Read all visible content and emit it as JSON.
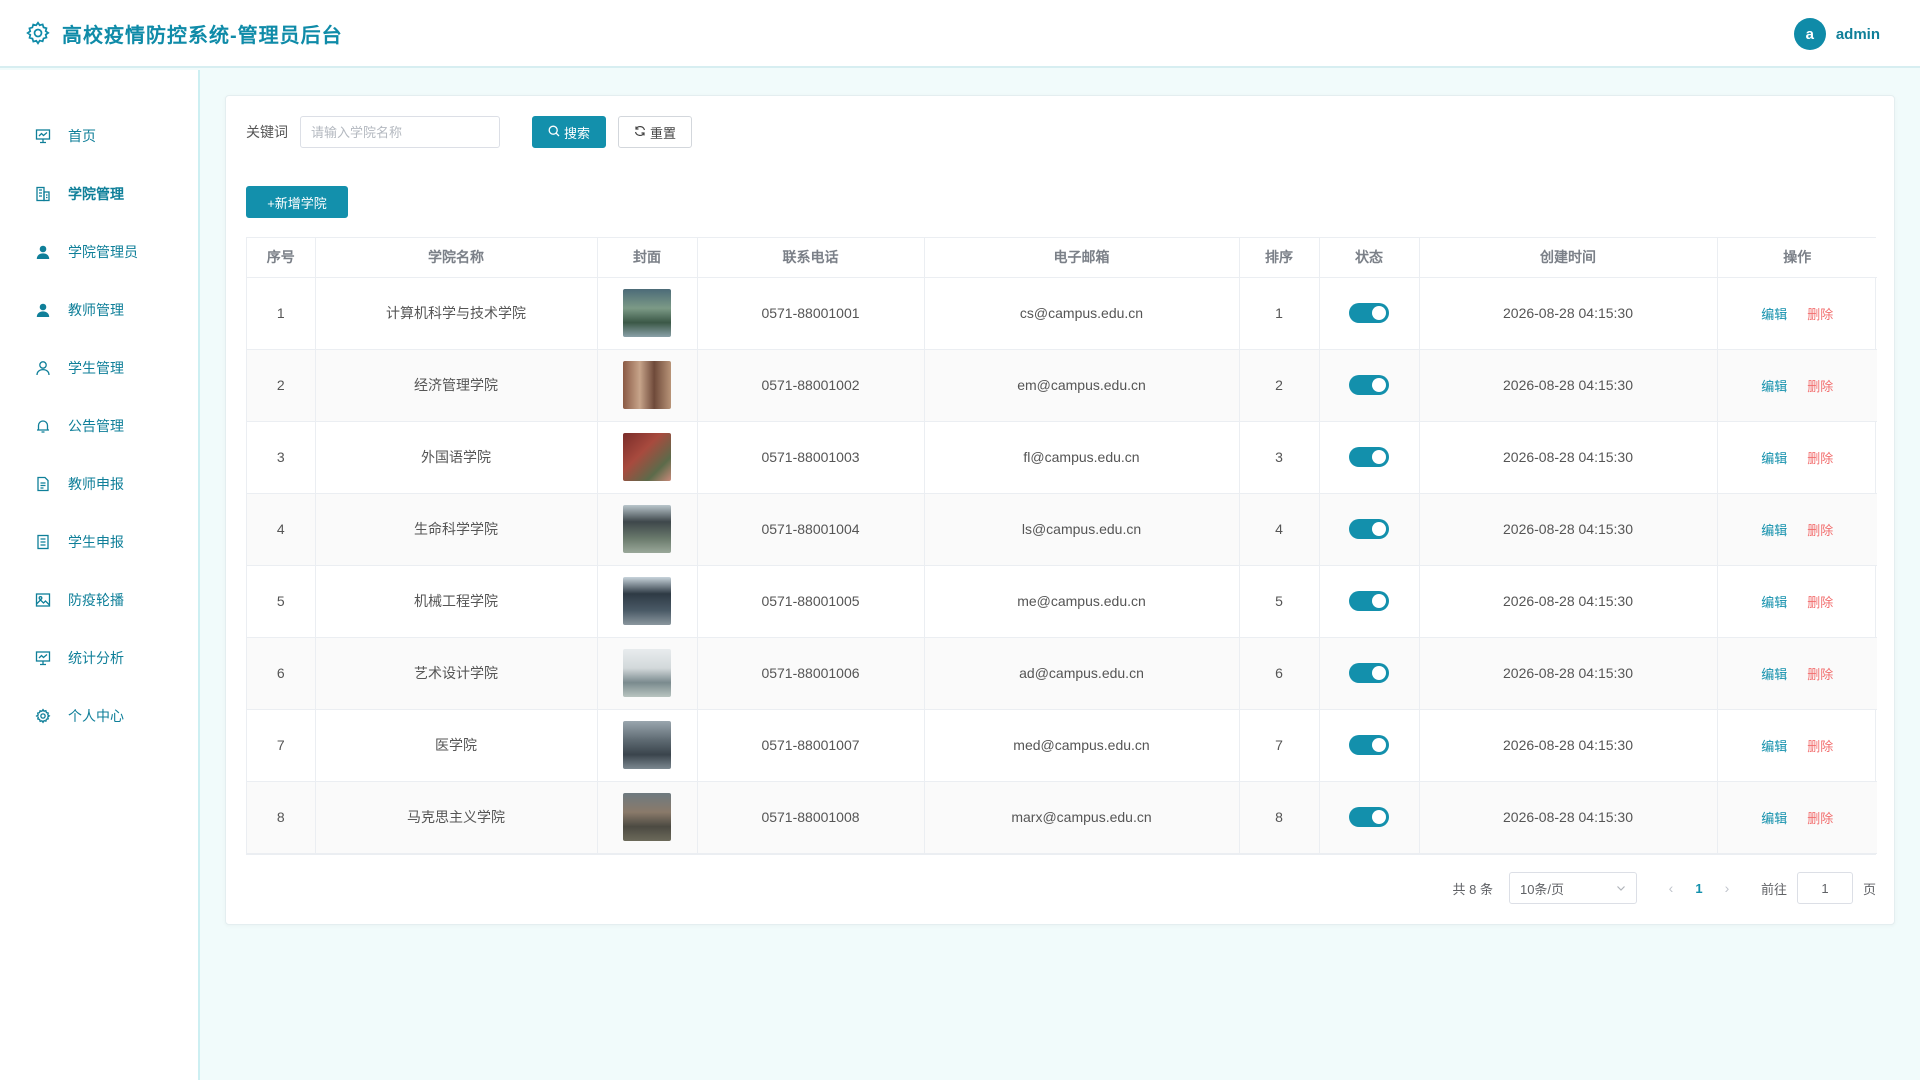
{
  "header": {
    "title": "高校疫情防控系统-管理员后台",
    "logo_icon": "gear-icon",
    "user": {
      "avatar_letter": "a",
      "name": "admin"
    }
  },
  "sidebar": {
    "items": [
      {
        "label": "首页",
        "icon": "presentation-icon"
      },
      {
        "label": "学院管理",
        "icon": "building-icon",
        "active": true
      },
      {
        "label": "学院管理员",
        "icon": "user-filled-icon"
      },
      {
        "label": "教师管理",
        "icon": "user-filled-icon"
      },
      {
        "label": "学生管理",
        "icon": "user-outline-icon"
      },
      {
        "label": "公告管理",
        "icon": "bell-icon"
      },
      {
        "label": "教师申报",
        "icon": "document-icon"
      },
      {
        "label": "学生申报",
        "icon": "tickets-icon"
      },
      {
        "label": "防疫轮播",
        "icon": "picture-icon"
      },
      {
        "label": "统计分析",
        "icon": "presentation-icon"
      },
      {
        "label": "个人中心",
        "icon": "gear-icon"
      }
    ]
  },
  "search": {
    "keyword_label": "关键词",
    "keyword_placeholder": "请输入学院名称",
    "keyword_value": "",
    "search_label": "搜索",
    "reset_label": "重置"
  },
  "toolbar": {
    "add_label": "+新增学院"
  },
  "table": {
    "columns": [
      "序号",
      "学院名称",
      "封面",
      "联系电话",
      "电子邮箱",
      "排序",
      "状态",
      "创建时间",
      "操作"
    ],
    "edit_label": "编辑",
    "delete_label": "删除",
    "rows": [
      {
        "index": "1",
        "name": "计算机科学与技术学院",
        "phone": "0571-88001001",
        "email": "cs@campus.edu.cn",
        "sort": "1",
        "status": true,
        "created": "2026-08-28 04:15:30"
      },
      {
        "index": "2",
        "name": "经济管理学院",
        "phone": "0571-88001002",
        "email": "em@campus.edu.cn",
        "sort": "2",
        "status": true,
        "created": "2026-08-28 04:15:30"
      },
      {
        "index": "3",
        "name": "外国语学院",
        "phone": "0571-88001003",
        "email": "fl@campus.edu.cn",
        "sort": "3",
        "status": true,
        "created": "2026-08-28 04:15:30"
      },
      {
        "index": "4",
        "name": "生命科学学院",
        "phone": "0571-88001004",
        "email": "ls@campus.edu.cn",
        "sort": "4",
        "status": true,
        "created": "2026-08-28 04:15:30"
      },
      {
        "index": "5",
        "name": "机械工程学院",
        "phone": "0571-88001005",
        "email": "me@campus.edu.cn",
        "sort": "5",
        "status": true,
        "created": "2026-08-28 04:15:30"
      },
      {
        "index": "6",
        "name": "艺术设计学院",
        "phone": "0571-88001006",
        "email": "ad@campus.edu.cn",
        "sort": "6",
        "status": true,
        "created": "2026-08-28 04:15:30"
      },
      {
        "index": "7",
        "name": "医学院",
        "phone": "0571-88001007",
        "email": "med@campus.edu.cn",
        "sort": "7",
        "status": true,
        "created": "2026-08-28 04:15:30"
      },
      {
        "index": "8",
        "name": "马克思主义学院",
        "phone": "0571-88001008",
        "email": "marx@campus.edu.cn",
        "sort": "8",
        "status": true,
        "created": "2026-08-28 04:15:30"
      }
    ]
  },
  "pagination": {
    "total_text": "共 8 条",
    "page_size": "10条/页",
    "current_page": "1",
    "goto_label": "前往",
    "goto_value": "1",
    "page_suffix": "页"
  },
  "colors": {
    "primary": "#1390ac",
    "title": "#0f8ba8",
    "danger": "#f26d6d",
    "background": "#f1fbfb"
  }
}
